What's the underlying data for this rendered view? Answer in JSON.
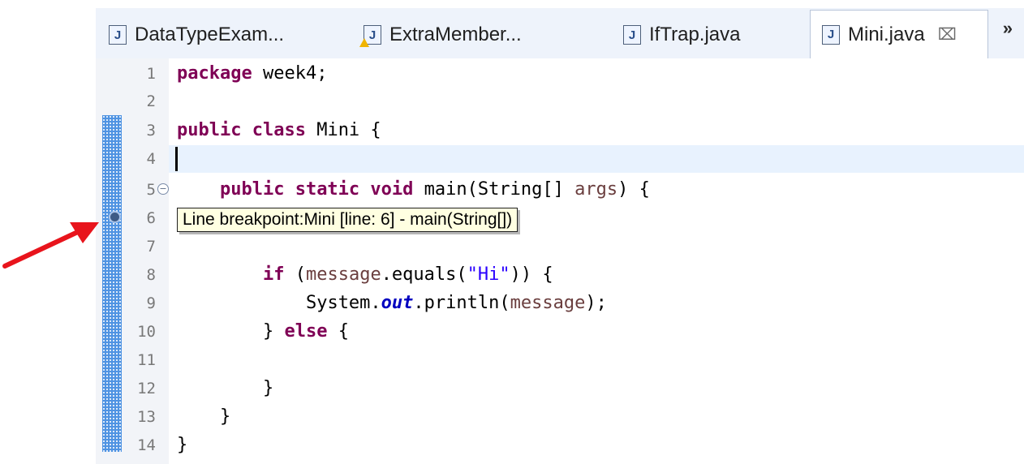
{
  "tabs": [
    {
      "label": "DataTypeExam...",
      "icon": "java-file-icon",
      "active": false
    },
    {
      "label": "ExtraMember...",
      "icon": "java-file-warning-icon",
      "active": false
    },
    {
      "label": "IfTrap.java",
      "icon": "java-file-icon",
      "active": false
    },
    {
      "label": "Mini.java",
      "icon": "java-file-icon",
      "active": true,
      "close": "⌧"
    }
  ],
  "overflow_label": "»",
  "tooltip": "Line breakpoint:Mini [line: 6] - main(String[])",
  "line_numbers": [
    "1",
    "2",
    "3",
    "4",
    "5",
    "6",
    "7",
    "8",
    "9",
    "10",
    "11",
    "12",
    "13",
    "14"
  ],
  "code": {
    "l1_kw": "package",
    "l1_rest": " week4;",
    "l3_kw": "public class",
    "l3_rest": " Mini {",
    "l5_indent": "    ",
    "l5_kw": "public static void",
    "l5_rest1": " main(String[] ",
    "l5_var": "args",
    "l5_rest2": ") {",
    "l8_indent": "        ",
    "l8_kw": "if",
    "l8_rest1": " (",
    "l8_var": "message",
    "l8_rest2": ".equals(",
    "l8_str": "\"Hi\"",
    "l8_rest3": ")) {",
    "l9_indent": "            ",
    "l9_rest1": "System.",
    "l9_fld": "out",
    "l9_rest2": ".println(",
    "l9_var": "message",
    "l9_rest3": ");",
    "l10_indent": "        ",
    "l10_rest1": "} ",
    "l10_kw": "else",
    "l10_rest2": " {",
    "l12": "        }",
    "l13": "    }",
    "l14": "}"
  },
  "colors": {
    "keyword": "#7f0055",
    "string": "#2a00ff",
    "field": "#0000c0",
    "variable": "#6a3e3e",
    "arrow": "#e8141c",
    "ruler_band": "#4f93e2"
  }
}
